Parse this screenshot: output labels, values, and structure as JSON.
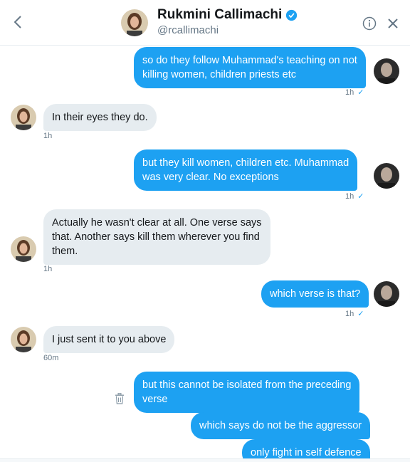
{
  "header": {
    "name": "Rukmini Callimachi",
    "handle": "@rcallimachi"
  },
  "messages": [
    {
      "side": "sent",
      "lines": [
        "so do they follow Muhammad's teaching on not",
        "killing women, children priests etc"
      ],
      "time": "1h"
    },
    {
      "side": "recv",
      "lines": [
        "In their eyes they do."
      ],
      "time": "1h"
    },
    {
      "side": "sent",
      "lines": [
        "but they kill women, children etc. Muhammad",
        "was very clear. No exceptions"
      ],
      "time": "1h"
    },
    {
      "side": "recv",
      "lines": [
        "Actually he wasn't clear at all. One verse says",
        "that. Another says kill them wherever you find",
        "them."
      ],
      "time": "1h"
    },
    {
      "side": "sent",
      "lines": [
        "which verse is that?"
      ],
      "time": "1h"
    },
    {
      "side": "recv",
      "lines": [
        "I just sent it to you above"
      ],
      "time": "60m"
    },
    {
      "side": "sent",
      "lines": [
        "but this cannot be isolated from the preceding",
        "verse"
      ]
    },
    {
      "side": "sent",
      "lines": [
        "which says do not be the aggressor"
      ]
    },
    {
      "side": "sent",
      "lines": [
        "only fight in self defence"
      ]
    }
  ],
  "colors": {
    "sent_bubble": "#1da1f2",
    "recv_bubble": "#e6ecf0",
    "verified": "#1da1f2",
    "timestamp": "#657786"
  },
  "icons": {
    "back": "chevron-left-icon",
    "info": "info-icon",
    "close": "close-icon",
    "delete": "trash-icon",
    "verified": "verified-badge-icon",
    "read": "checkmark-icon"
  }
}
